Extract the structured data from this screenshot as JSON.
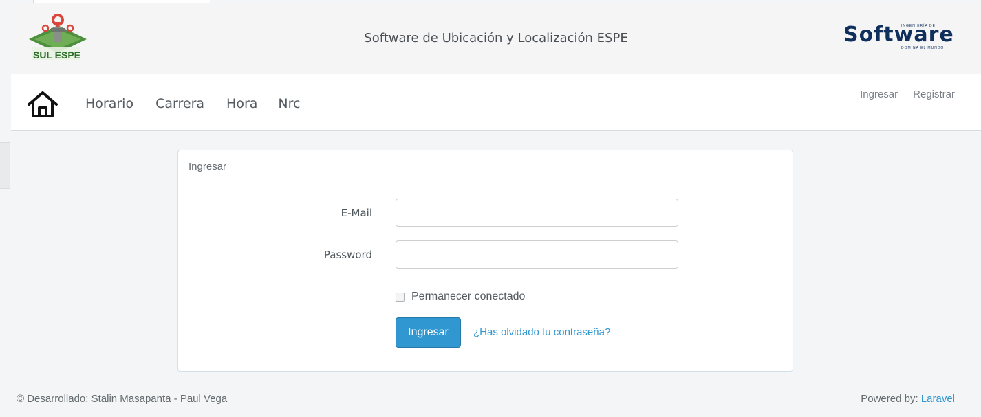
{
  "header": {
    "logo_text": "SUL ESPE",
    "site_title": "Software de Ubicación y Localización ESPE",
    "brand_logo": {
      "name": "Software",
      "top_text": "INGENIERÍA DE",
      "bottom_text": "DOMINA EL MUNDO"
    }
  },
  "navbar": {
    "home_icon": "home-icon",
    "links": [
      "Horario",
      "Carrera",
      "Hora",
      "Nrc"
    ],
    "right_links": [
      "Ingresar",
      "Registrar"
    ]
  },
  "login": {
    "panel_title": "Ingresar",
    "email_label": "E-Mail",
    "email_value": "",
    "password_label": "Password",
    "password_value": "",
    "remember_label": "Permanecer conectado",
    "remember_checked": false,
    "submit_label": "Ingresar",
    "forgot_link": "¿Has olvidado tu contraseña?"
  },
  "footer": {
    "credit": "© Desarrollado: Stalin Masapanta - Paul Vega",
    "powered_prefix": "Powered by: ",
    "powered_link": "Laravel"
  },
  "colors": {
    "primary": "#3097d1",
    "page_background": "#f4f5f7",
    "card_border": "#d3e0e9",
    "logo_green": "#3f8a36",
    "logo_red": "#d9463c",
    "brand_navy": "#0f2f5c"
  }
}
